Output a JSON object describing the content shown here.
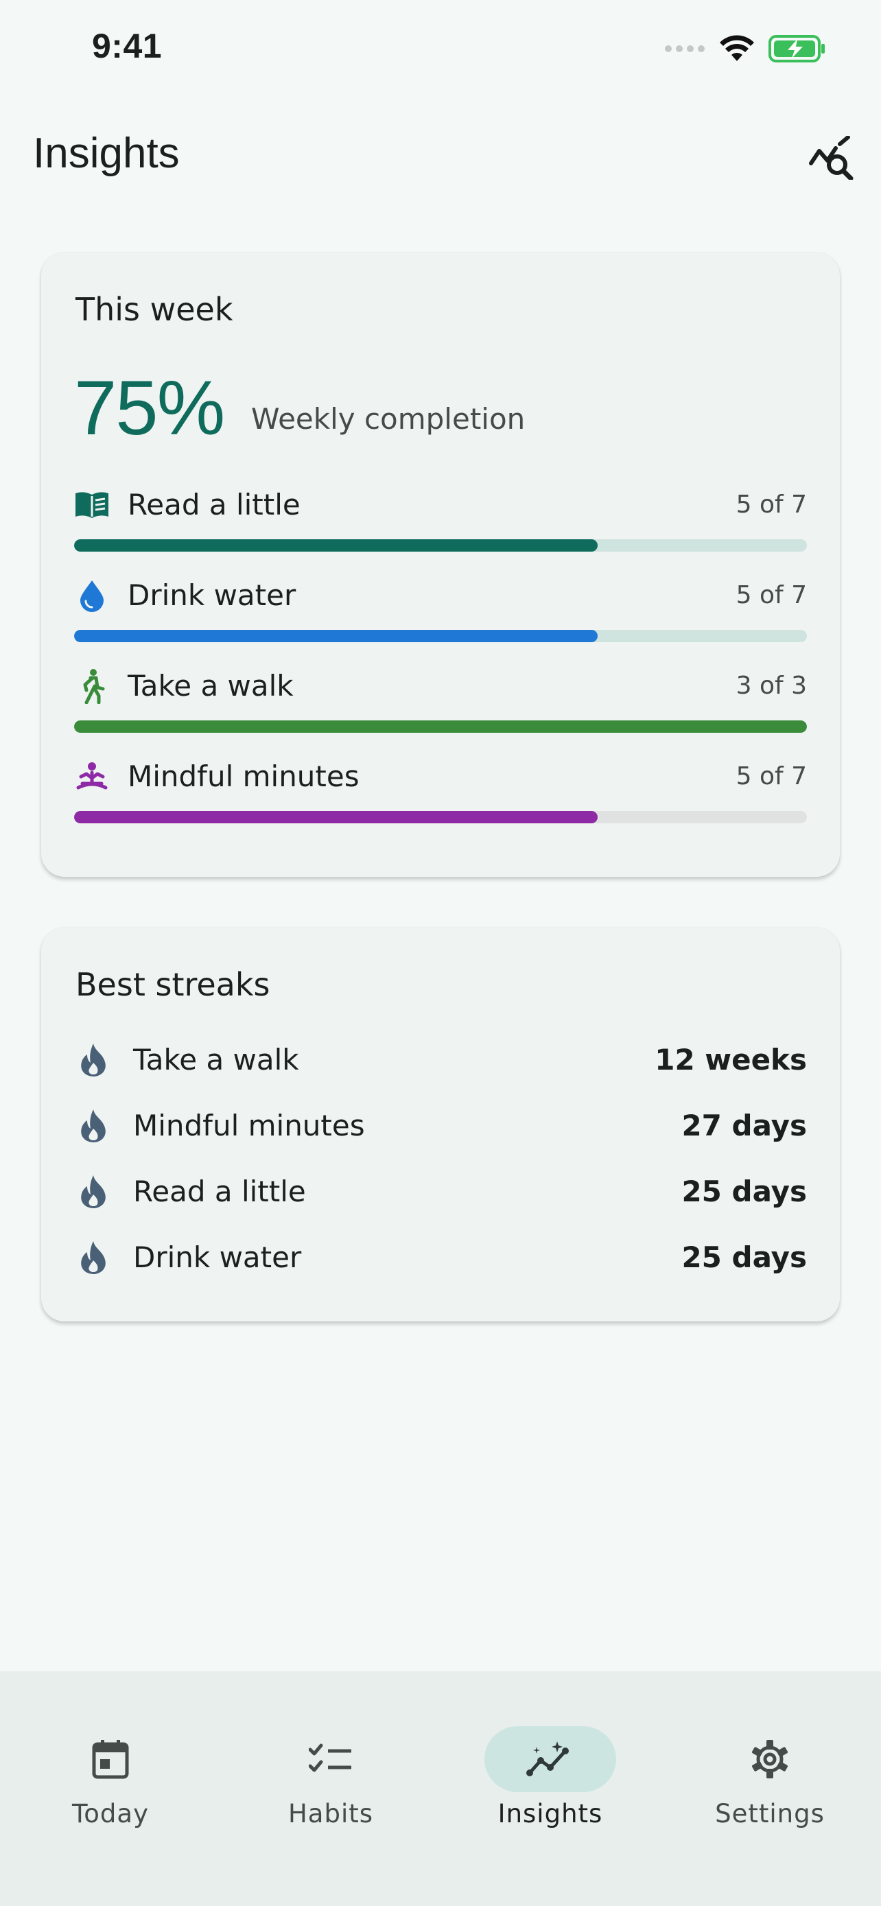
{
  "status_bar": {
    "time": "9:41"
  },
  "header": {
    "title": "Insights",
    "action_icon": "query-stats-icon"
  },
  "week": {
    "title": "This week",
    "completion_value": "75%",
    "completion_caption": "Weekly completion",
    "habits": [
      {
        "name": "Read a little",
        "count": "5 of 7",
        "progress": 0.714,
        "color": "#0f6b5c",
        "track": "#cfe3df",
        "icon": "book-icon"
      },
      {
        "name": "Drink water",
        "count": "5 of 7",
        "progress": 0.714,
        "color": "#1f78d6",
        "track": "#cfe3df",
        "icon": "water-drop-icon"
      },
      {
        "name": "Take a walk",
        "count": "3 of 3",
        "progress": 1.0,
        "color": "#3a8c3b",
        "track": "#cfe3df",
        "icon": "walk-icon"
      },
      {
        "name": "Mindful minutes",
        "count": "5 of 7",
        "progress": 0.714,
        "color": "#8e2aa6",
        "track": "#e0e2e1",
        "icon": "meditation-icon"
      }
    ]
  },
  "streaks": {
    "title": "Best streaks",
    "items": [
      {
        "name": "Take a walk",
        "value": "12 weeks"
      },
      {
        "name": "Mindful minutes",
        "value": "27 days"
      },
      {
        "name": "Read a little",
        "value": "25 days"
      },
      {
        "name": "Drink water",
        "value": "25 days"
      }
    ]
  },
  "nav": {
    "items": [
      {
        "label": "Today",
        "icon": "calendar-icon",
        "active": false
      },
      {
        "label": "Habits",
        "icon": "checklist-icon",
        "active": false
      },
      {
        "label": "Insights",
        "icon": "insights-icon",
        "active": true
      },
      {
        "label": "Settings",
        "icon": "gear-icon",
        "active": false
      }
    ]
  },
  "colors": {
    "accent": "#0f6b5c",
    "background": "#f4f9f7",
    "card": "#eff4f2",
    "nav_active": "#cde5e1"
  }
}
